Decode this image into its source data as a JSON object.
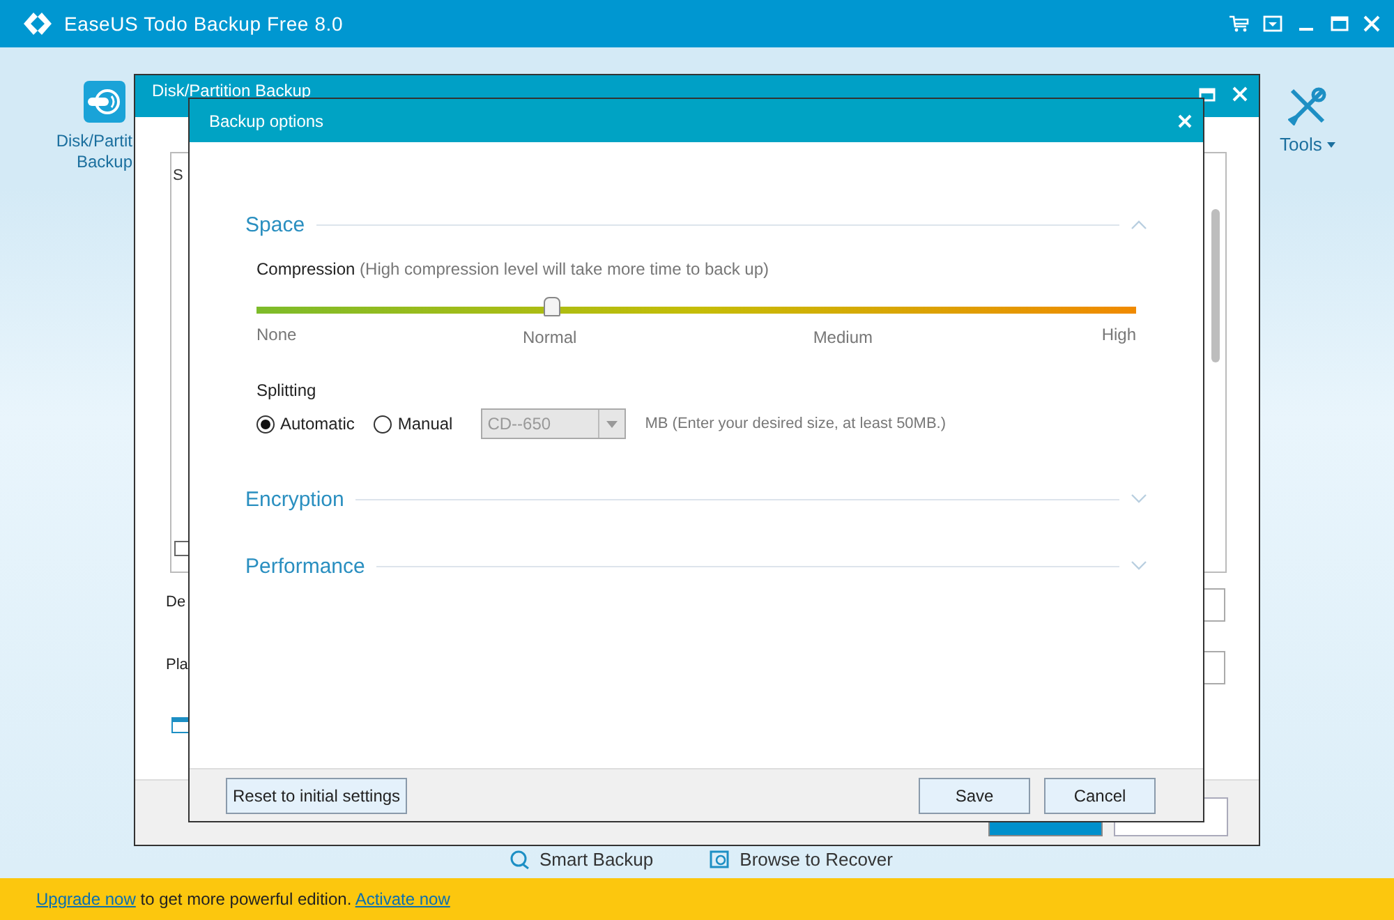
{
  "app": {
    "title": "EaseUS Todo Backup Free 8.0"
  },
  "toolbar": {
    "left_item": {
      "label_lines": [
        "Disk/Partit",
        "Backup"
      ]
    },
    "tools": {
      "label": "Tools"
    }
  },
  "background_window": {
    "title": "Disk/Partition Backup",
    "list_text": "S",
    "list_checkbox": {
      "checked": false
    },
    "field_labels": [
      "De",
      "Pla"
    ],
    "bottom_links": [
      "Smart Backup",
      "Browse to Recover"
    ]
  },
  "dialog": {
    "title": "Backup options",
    "sections": [
      {
        "title": "Space",
        "expanded": true
      },
      {
        "title": "Encryption",
        "expanded": false
      },
      {
        "title": "Performance",
        "expanded": false
      }
    ],
    "compression": {
      "label": "Compression",
      "hint": "(High compression level will take more time to back up)",
      "level": 0.335,
      "ticks": [
        "None",
        "Normal",
        "Medium",
        "High"
      ]
    },
    "splitting": {
      "label": "Splitting",
      "options": [
        {
          "label": "Automatic",
          "selected": true
        },
        {
          "label": "Manual",
          "selected": false
        }
      ],
      "size": {
        "value": "CD--650",
        "disabled": true
      },
      "note": "MB (Enter your desired size, at least 50MB.)"
    },
    "buttons": {
      "reset": "Reset to initial settings",
      "save": "Save",
      "cancel": "Cancel"
    }
  },
  "status_bar": {
    "upgrade_link": "Upgrade now",
    "message": "to get more powerful edition.",
    "activate_link": "Activate now"
  }
}
